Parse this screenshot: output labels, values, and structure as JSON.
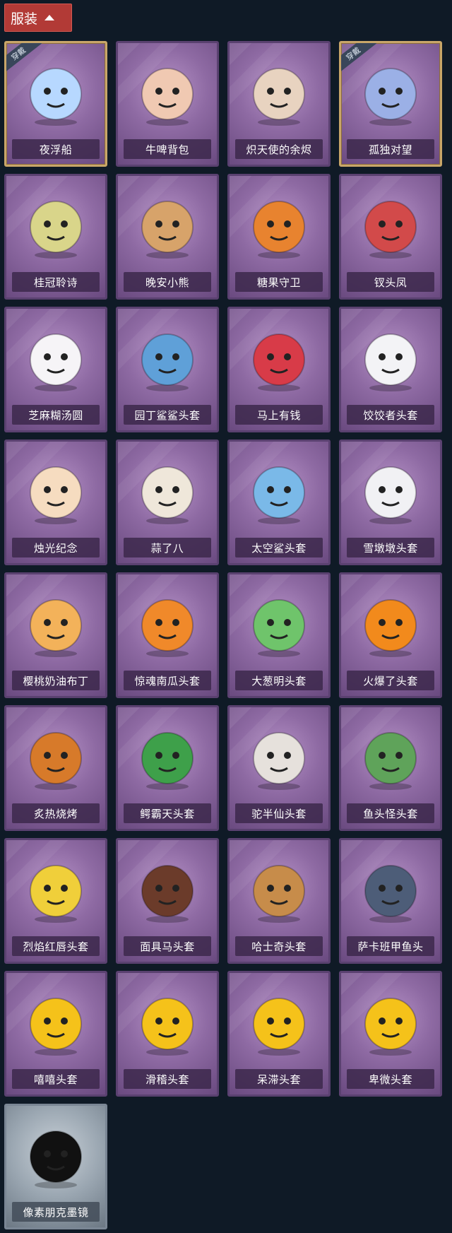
{
  "header": {
    "title": "服装"
  },
  "badge_text": "穿戴",
  "items": [
    {
      "label": "夜浮船",
      "worn": true,
      "icon": "jellyfish-icon",
      "color": "#b7d8ff"
    },
    {
      "label": "牛啤背包",
      "icon": "cow-barrel-icon",
      "color": "#f0c9b2"
    },
    {
      "label": "炽天使的余烬",
      "icon": "angel-girl-icon",
      "color": "#e8d3c0"
    },
    {
      "label": "孤独对望",
      "worn": true,
      "icon": "charm-icon",
      "color": "#9bb0e6"
    },
    {
      "label": "桂冠聆诗",
      "icon": "laurel-charm-icon",
      "color": "#d9d58a"
    },
    {
      "label": "晚安小熊",
      "icon": "bear-icon",
      "color": "#d7a36a"
    },
    {
      "label": "糖果守卫",
      "icon": "pumpkin-charm-icon",
      "color": "#e8832f"
    },
    {
      "label": "钗头凤",
      "icon": "phoenix-crown-icon",
      "color": "#d24a4a"
    },
    {
      "label": "芝麻糊汤圆",
      "icon": "dumpling-icon",
      "color": "#f6f4f7"
    },
    {
      "label": "园丁鲨鲨头套",
      "icon": "shark-icon",
      "color": "#5fa0d8"
    },
    {
      "label": "马上有钱",
      "icon": "horse-icon",
      "color": "#d83b48"
    },
    {
      "label": "饺饺者头套",
      "icon": "cloud-face-icon",
      "color": "#f3f3f6"
    },
    {
      "label": "烛光纪念",
      "icon": "candle-icon",
      "color": "#f6dcc0"
    },
    {
      "label": "蒜了八",
      "icon": "garlic-icon",
      "color": "#efe7da"
    },
    {
      "label": "太空鲨头套",
      "icon": "space-shark-icon",
      "color": "#7ab9e8"
    },
    {
      "label": "雪墩墩头套",
      "icon": "snowman-icon",
      "color": "#f1f1f4"
    },
    {
      "label": "樱桃奶油布丁",
      "icon": "pudding-icon",
      "color": "#f3b25a"
    },
    {
      "label": "惊魂南瓜头套",
      "icon": "pumpkin-icon",
      "color": "#f0892a"
    },
    {
      "label": "大葱明头套",
      "icon": "scallion-icon",
      "color": "#6fc46b"
    },
    {
      "label": "火爆了头套",
      "icon": "fire-icon",
      "color": "#f28a1c"
    },
    {
      "label": "炙热烧烤",
      "icon": "bbq-icon",
      "color": "#d77a2a"
    },
    {
      "label": "鳄霸天头套",
      "icon": "crocodile-icon",
      "color": "#3ea04a"
    },
    {
      "label": "驼半仙头套",
      "icon": "alpaca-icon",
      "color": "#e6e1dc"
    },
    {
      "label": "鱼头怪头套",
      "icon": "fish-head-icon",
      "color": "#5fa35a"
    },
    {
      "label": "烈焰红唇头套",
      "icon": "yellow-mascot-icon",
      "color": "#f0cf3a"
    },
    {
      "label": "面具马头套",
      "icon": "horse-mask-icon",
      "color": "#6b3b2a"
    },
    {
      "label": "哈士奇头套",
      "icon": "husky-icon",
      "color": "#c78c4a"
    },
    {
      "label": "萨卡班甲鱼头",
      "icon": "fish-icon",
      "color": "#4d5d78"
    },
    {
      "label": "嘻嘻头套",
      "icon": "grin-emoji-icon",
      "color": "#f5c21a"
    },
    {
      "label": "滑稽头套",
      "icon": "funny-emoji-icon",
      "color": "#f5c21a"
    },
    {
      "label": "呆滞头套",
      "icon": "dazed-emoji-icon",
      "color": "#f5c21a"
    },
    {
      "label": "卑微头套",
      "icon": "humble-emoji-icon",
      "color": "#f5c21a"
    },
    {
      "label": "像素朋克墨镜",
      "silver": true,
      "icon": "pixel-sunglasses-icon",
      "color": "#111111"
    }
  ]
}
